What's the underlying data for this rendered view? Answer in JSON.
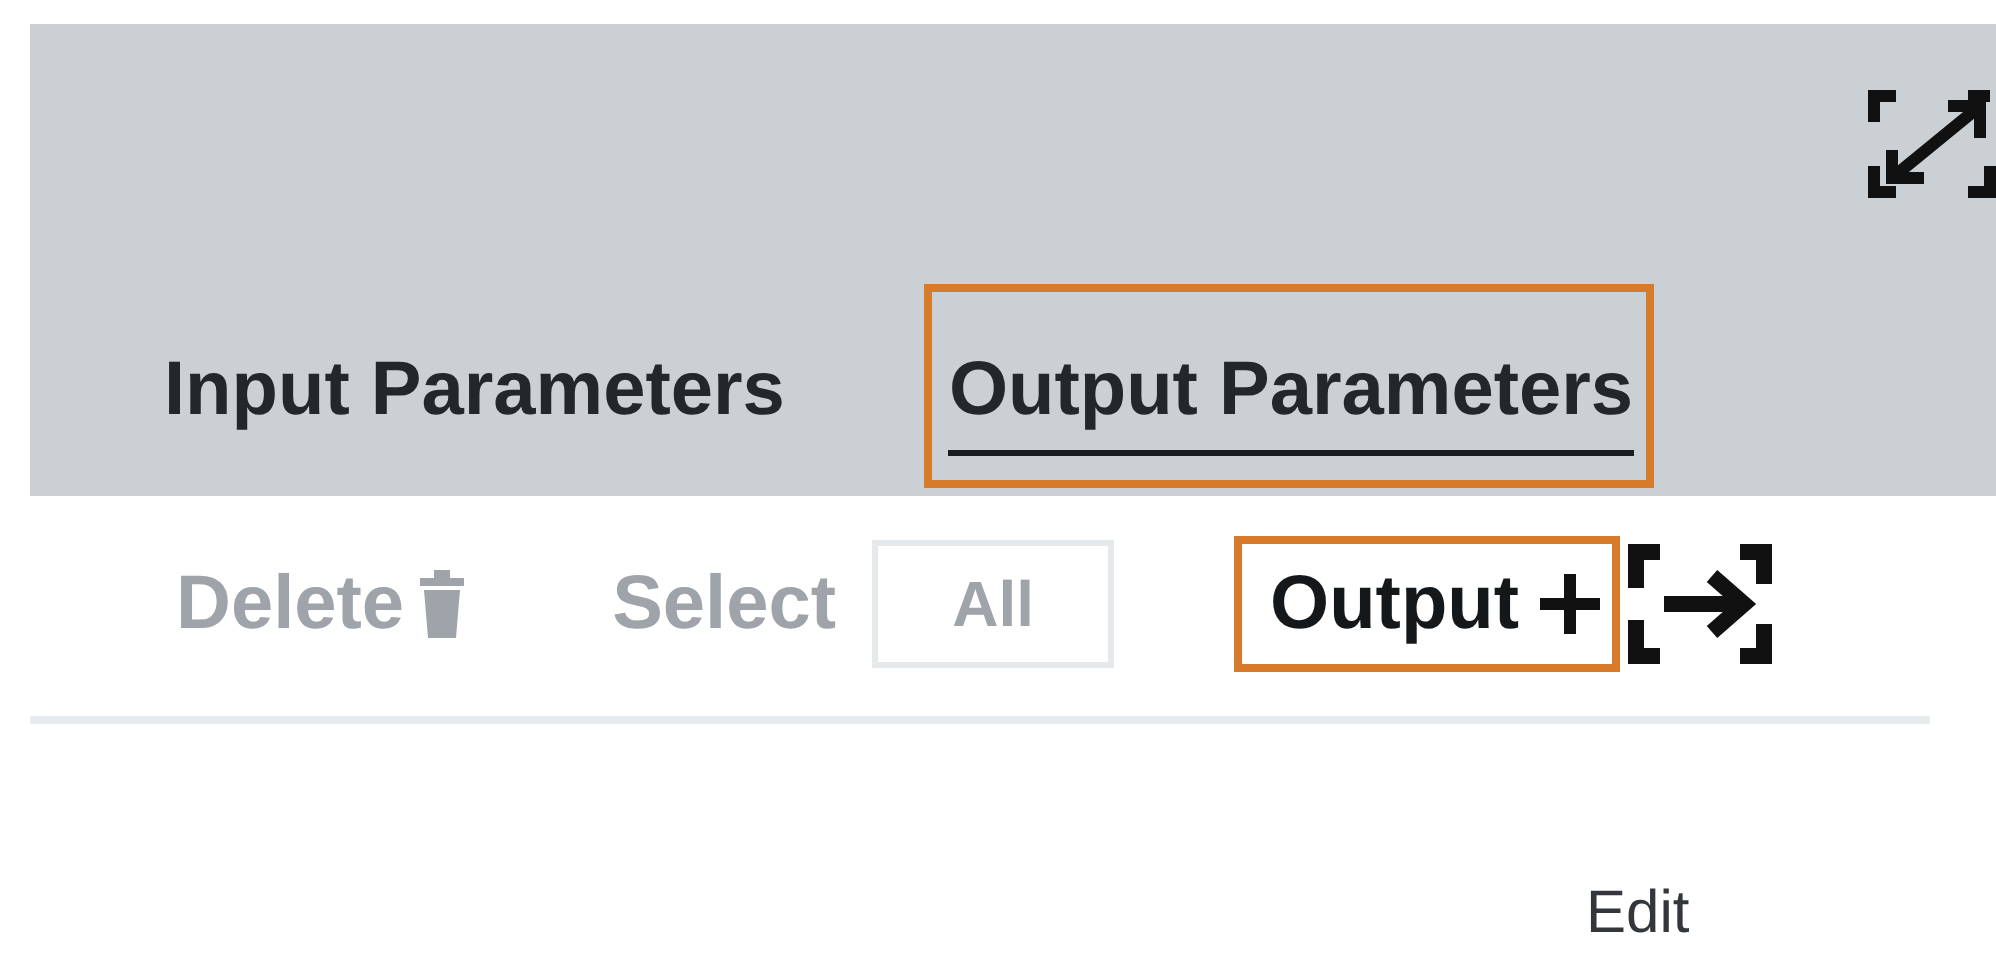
{
  "tabs": [
    {
      "label": "Input Parameters",
      "selected": false,
      "highlighted": false
    },
    {
      "label": "Output Parameters",
      "selected": true,
      "highlighted": true
    }
  ],
  "toolbar": {
    "delete": {
      "label": "Delete",
      "disabled": true
    },
    "select": {
      "label": "Select",
      "disabled": true
    },
    "all": {
      "label": "All",
      "disabled": true
    },
    "add_output": {
      "label": "Output",
      "highlighted": true
    }
  },
  "column_1": {
    "label": "Edit"
  }
}
